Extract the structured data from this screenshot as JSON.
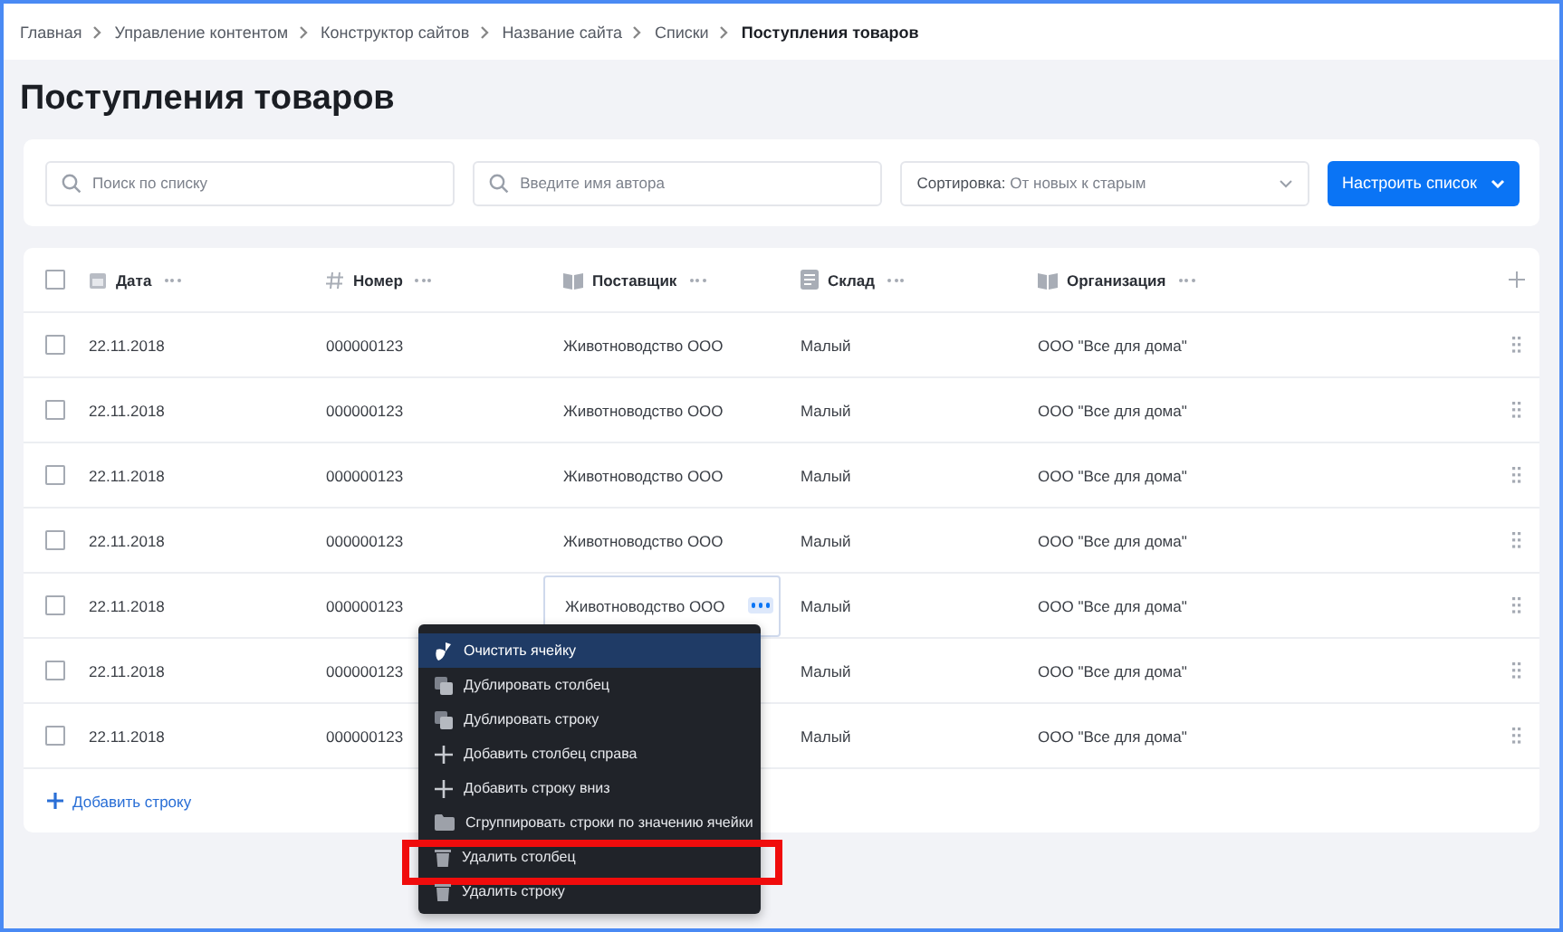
{
  "breadcrumbs": [
    {
      "label": "Главная",
      "current": false
    },
    {
      "label": "Управление контентом",
      "current": false
    },
    {
      "label": "Конструктор сайтов",
      "current": false
    },
    {
      "label": "Название сайта",
      "current": false
    },
    {
      "label": "Списки",
      "current": false
    },
    {
      "label": "Поступления товаров",
      "current": true
    }
  ],
  "title": "Поступления товаров",
  "filters": {
    "search": {
      "placeholder": "Поиск по списку"
    },
    "author": {
      "placeholder": "Введите имя автора"
    },
    "sort": {
      "label": "Сортировка:",
      "value": "От новых к старым"
    },
    "configure_button": "Настроить список"
  },
  "table": {
    "all_checked": false,
    "columns": [
      {
        "label": "Дата",
        "kind": "calendar"
      },
      {
        "label": "Номер",
        "kind": "hash"
      },
      {
        "label": "Поставщик",
        "kind": "book"
      },
      {
        "label": "Склад",
        "kind": "document"
      },
      {
        "label": "Организация",
        "kind": "book"
      }
    ],
    "rows": [
      {
        "checked": false,
        "cells": [
          {
            "text": "22.11.2018",
            "selected": false
          },
          {
            "text": "000000123",
            "selected": false
          },
          {
            "text": "Животноводство ООО",
            "selected": false
          },
          {
            "text": "Малый",
            "selected": false
          },
          {
            "text": "ООО \"Все для дома\"",
            "selected": false
          }
        ]
      },
      {
        "checked": false,
        "cells": [
          {
            "text": "22.11.2018",
            "selected": false
          },
          {
            "text": "000000123",
            "selected": false
          },
          {
            "text": "Животноводство ООО",
            "selected": false
          },
          {
            "text": "Малый",
            "selected": false
          },
          {
            "text": "ООО \"Все для дома\"",
            "selected": false
          }
        ]
      },
      {
        "checked": false,
        "cells": [
          {
            "text": "22.11.2018",
            "selected": false
          },
          {
            "text": "000000123",
            "selected": false
          },
          {
            "text": "Животноводство ООО",
            "selected": false
          },
          {
            "text": "Малый",
            "selected": false
          },
          {
            "text": "ООО \"Все для дома\"",
            "selected": false
          }
        ]
      },
      {
        "checked": false,
        "cells": [
          {
            "text": "22.11.2018",
            "selected": false
          },
          {
            "text": "000000123",
            "selected": false
          },
          {
            "text": "Животноводство ООО",
            "selected": false
          },
          {
            "text": "Малый",
            "selected": false
          },
          {
            "text": "ООО \"Все для дома\"",
            "selected": false
          }
        ]
      },
      {
        "checked": false,
        "cells": [
          {
            "text": "22.11.2018",
            "selected": false
          },
          {
            "text": "000000123",
            "selected": false
          },
          {
            "text": "Животноводство ООО",
            "selected": true
          },
          {
            "text": "Малый",
            "selected": false
          },
          {
            "text": "ООО \"Все для дома\"",
            "selected": false
          }
        ]
      },
      {
        "checked": false,
        "cells": [
          {
            "text": "22.11.2018",
            "selected": false
          },
          {
            "text": "000000123",
            "selected": false
          },
          null,
          {
            "text": "Малый",
            "selected": false
          },
          {
            "text": "ООО \"Все для дома\"",
            "selected": false
          }
        ]
      },
      {
        "checked": false,
        "cells": [
          {
            "text": "22.11.2018",
            "selected": false
          },
          {
            "text": "000000123",
            "selected": false
          },
          null,
          {
            "text": "Малый",
            "selected": false
          },
          {
            "text": "ООО \"Все для дома\"",
            "selected": false
          }
        ]
      }
    ],
    "add_row": "Добавить строку"
  },
  "context_menu": {
    "items": [
      {
        "label": "Очистить ячейку",
        "kind": "clear",
        "hovered": true,
        "highlighted": false
      },
      {
        "label": "Дублировать столбец",
        "kind": "duplicate",
        "hovered": false,
        "highlighted": false
      },
      {
        "label": "Дублировать строку",
        "kind": "duplicate",
        "hovered": false,
        "highlighted": false
      },
      {
        "label": "Добавить столбец справа",
        "kind": "add",
        "hovered": false,
        "highlighted": false
      },
      {
        "label": "Добавить строку вниз",
        "kind": "add",
        "hovered": false,
        "highlighted": false
      },
      {
        "label": "Сгруппировать строки по значению ячейки",
        "kind": "group",
        "hovered": false,
        "highlighted": false
      },
      {
        "label": "Удалить столбец",
        "kind": "delete",
        "hovered": false,
        "highlighted": true
      },
      {
        "label": "Удалить строку",
        "kind": "delete",
        "hovered": false,
        "highlighted": false
      }
    ]
  }
}
